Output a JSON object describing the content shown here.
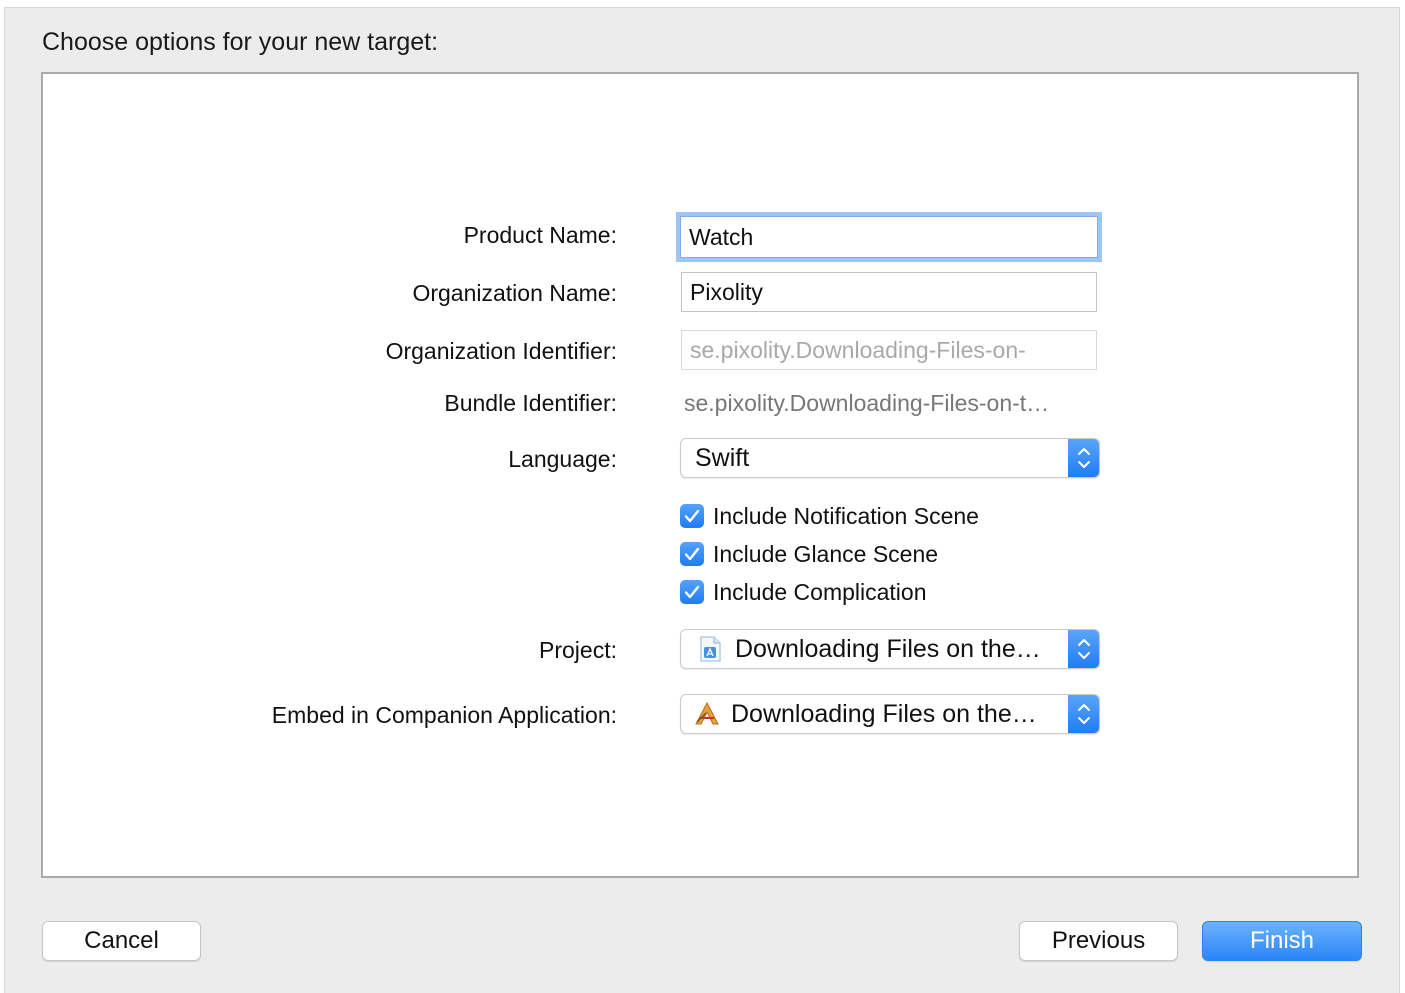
{
  "dialog": {
    "heading": "Choose options for your new target:"
  },
  "form": {
    "product_name": {
      "label": "Product Name:",
      "value": "Watch"
    },
    "organization_name": {
      "label": "Organization Name:",
      "value": "Pixolity"
    },
    "organization_identifier": {
      "label": "Organization Identifier:",
      "value": "se.pixolity.Downloading-Files-on-"
    },
    "bundle_identifier": {
      "label": "Bundle Identifier:",
      "value": "se.pixolity.Downloading-Files-on-t…"
    },
    "language": {
      "label": "Language:",
      "value": "Swift"
    },
    "checkboxes": [
      {
        "label": "Include Notification Scene",
        "checked": true
      },
      {
        "label": "Include Glance Scene",
        "checked": true
      },
      {
        "label": "Include Complication",
        "checked": true
      }
    ],
    "project": {
      "label": "Project:",
      "value": "Downloading Files on the…",
      "icon": "xcode-project-file-icon"
    },
    "companion": {
      "label": "Embed in Companion Application:",
      "value": "Downloading Files on the…",
      "icon": "app-target-icon"
    }
  },
  "buttons": {
    "cancel": "Cancel",
    "previous": "Previous",
    "finish": "Finish"
  },
  "colors": {
    "accent": "#2a86f6",
    "focus_ring": "#9fc5f3"
  }
}
